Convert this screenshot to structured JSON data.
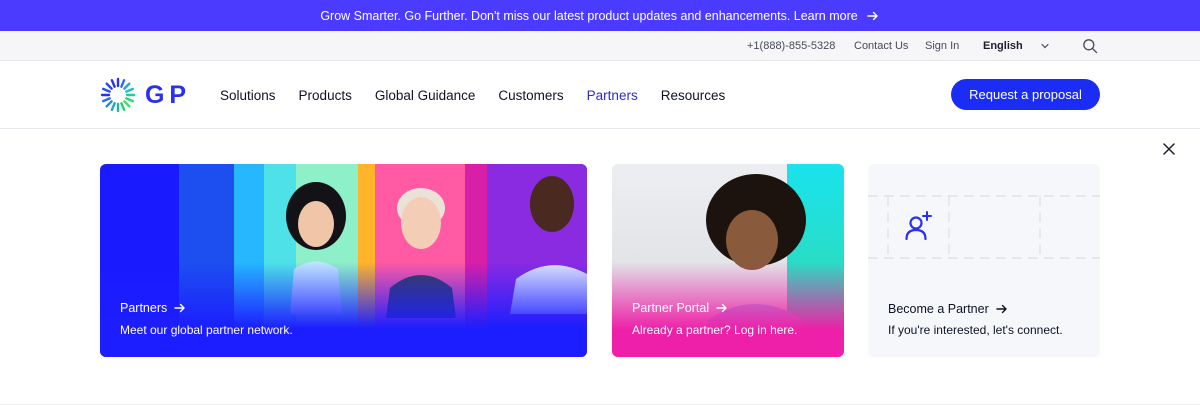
{
  "announcement": {
    "text": "Grow Smarter. Go Further. Don't miss our latest product updates and enhancements. Learn more",
    "arrow_icon": "arrow-right-icon"
  },
  "utility": {
    "phone": "+1(888)-855-5328",
    "contact": "Contact Us",
    "signin": "Sign In",
    "language": "English"
  },
  "brand": {
    "logo_text": "G P",
    "primary_color": "#1b2cf5",
    "announce_color": "#4b3bff"
  },
  "nav": {
    "items": [
      {
        "label": "Solutions"
      },
      {
        "label": "Products"
      },
      {
        "label": "Global Guidance"
      },
      {
        "label": "Customers"
      },
      {
        "label": "Partners"
      },
      {
        "label": "Resources"
      }
    ],
    "active_index": 4,
    "cta": "Request a proposal"
  },
  "cards": [
    {
      "title": "Partners",
      "subtitle": "Meet our global partner network."
    },
    {
      "title": "Partner Portal",
      "subtitle": "Already a partner? Log in here."
    },
    {
      "title": "Become a Partner",
      "subtitle": "If you're interested, let's connect.",
      "icon": "add-user-icon"
    }
  ]
}
